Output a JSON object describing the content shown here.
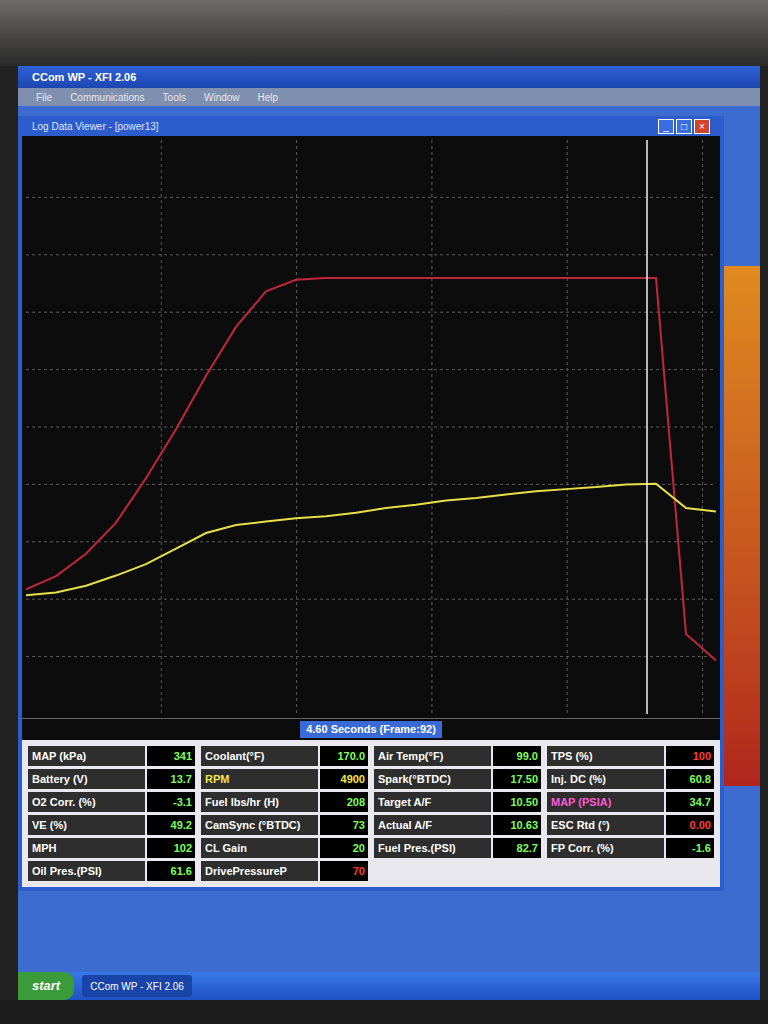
{
  "app_window": {
    "title": "CCom WP - XFI 2.06",
    "menu": [
      "File",
      "Communications",
      "Tools",
      "Window",
      "Help"
    ]
  },
  "log_window": {
    "title": "Log Data Viewer - [power13]",
    "controls": [
      "_",
      "□",
      "×"
    ]
  },
  "chart": {
    "time_label": "4.60 Seconds (Frame:92)",
    "cursor_level": 0.9,
    "series": [
      {
        "name": "RPM",
        "color": "#c0283a",
        "values": [
          1400,
          1550,
          1800,
          2150,
          2650,
          3200,
          3800,
          4350,
          4750,
          4880,
          4900,
          4900,
          4900,
          4900,
          4900,
          4900,
          4900,
          4900,
          4900,
          4900,
          4900,
          4900,
          900,
          600
        ]
      },
      {
        "name": "MAP (kPa)",
        "color": "#e8e04a",
        "values": [
          176,
          180,
          190,
          205,
          222,
          245,
          268,
          280,
          285,
          290,
          293,
          298,
          305,
          310,
          316,
          320,
          325,
          330,
          333,
          336,
          340,
          341,
          305,
          300
        ]
      }
    ]
  },
  "readouts": [
    [
      {
        "label": "MAP (kPa)",
        "value": "341",
        "label_color": "#ffffff",
        "value_color": "#7dff5a"
      },
      {
        "label": "Battery (V)",
        "value": "13.7",
        "label_color": "#ffffff",
        "value_color": "#7dff5a"
      },
      {
        "label": "O2 Corr. (%)",
        "value": "-3.1",
        "label_color": "#ffffff",
        "value_color": "#7dff5a"
      },
      {
        "label": "VE (%)",
        "value": "49.2",
        "label_color": "#ffffff",
        "value_color": "#7dff5a"
      },
      {
        "label": "MPH",
        "value": "102",
        "label_color": "#ffffff",
        "value_color": "#7dff5a"
      },
      {
        "label": "Oil Pres.(PSI)",
        "value": "61.6",
        "label_color": "#ffffff",
        "value_color": "#7dff5a"
      }
    ],
    [
      {
        "label": "Coolant(°F)",
        "value": "170.0",
        "label_color": "#ffffff",
        "value_color": "#7dff5a"
      },
      {
        "label": "RPM",
        "value": "4900",
        "label_color": "#f2e64a",
        "value_color": "#f2e64a"
      },
      {
        "label": "Fuel lbs/hr (H)",
        "value": "208",
        "label_color": "#ffffff",
        "value_color": "#7dff5a"
      },
      {
        "label": "CamSync (°BTDC)",
        "value": "73",
        "label_color": "#ffffff",
        "value_color": "#7dff5a"
      },
      {
        "label": "CL Gain",
        "value": "20",
        "label_color": "#ffffff",
        "value_color": "#7dff5a"
      },
      {
        "label": "DrivePressureP",
        "value": "70",
        "label_color": "#ffffff",
        "value_color": "#ff3b3b"
      }
    ],
    [
      {
        "label": "Air Temp(°F)",
        "value": "99.0",
        "label_color": "#ffffff",
        "value_color": "#7dff5a"
      },
      {
        "label": "Spark(°BTDC)",
        "value": "17.50",
        "label_color": "#ffffff",
        "value_color": "#7dff5a"
      },
      {
        "label": "Target A/F",
        "value": "10.50",
        "label_color": "#ffffff",
        "value_color": "#7dff5a"
      },
      {
        "label": "Actual A/F",
        "value": "10.63",
        "label_color": "#ffffff",
        "value_color": "#7dff5a"
      },
      {
        "label": "Fuel Pres.(PSI)",
        "value": "82.7",
        "label_color": "#ffffff",
        "value_color": "#7dff5a"
      }
    ],
    [
      {
        "label": "TPS (%)",
        "value": "100",
        "label_color": "#ffffff",
        "value_color": "#ff3b3b"
      },
      {
        "label": "Inj. DC (%)",
        "value": "60.8",
        "label_color": "#ffffff",
        "value_color": "#7dff5a"
      },
      {
        "label": "MAP (PSIA)",
        "value": "34.7",
        "label_color": "#ff5ad2",
        "value_color": "#7dff5a"
      },
      {
        "label": "ESC Rtd (°)",
        "value": "0.00",
        "label_color": "#ffffff",
        "value_color": "#ff3b3b"
      },
      {
        "label": "FP Corr. (%)",
        "value": "-1.6",
        "label_color": "#ffffff",
        "value_color": "#7dff5a"
      }
    ]
  ],
  "taskbar": {
    "start": "start",
    "tasks": [
      {
        "label": "CCom WP - XFI 2.06",
        "selected": true
      }
    ]
  }
}
